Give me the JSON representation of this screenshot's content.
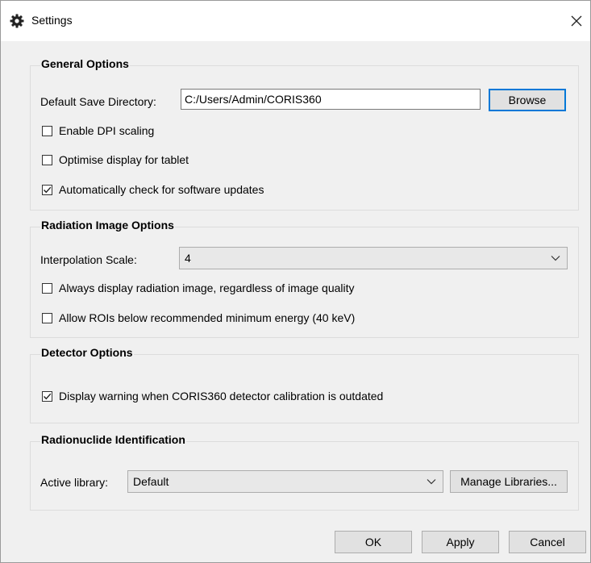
{
  "window": {
    "title": "Settings",
    "icon": "gear-icon",
    "close_glyph": "✕"
  },
  "general": {
    "title": "General Options",
    "save_dir_label": "Default Save Directory:",
    "save_dir_value": "C:/Users/Admin/CORIS360",
    "browse_label": "Browse",
    "checks": [
      {
        "label": "Enable DPI scaling",
        "checked": false
      },
      {
        "label": "Optimise display for tablet",
        "checked": false
      },
      {
        "label": "Automatically check for software updates",
        "checked": true
      }
    ]
  },
  "radiation": {
    "title": "Radiation Image Options",
    "interp_label": "Interpolation Scale:",
    "interp_value": "4",
    "checks": [
      {
        "label": "Always display radiation image, regardless of image quality",
        "checked": false
      },
      {
        "label": "Allow ROIs below recommended minimum energy (40 keV)",
        "checked": false
      }
    ]
  },
  "detector": {
    "title": "Detector Options",
    "checks": [
      {
        "label": "Display warning when CORIS360 detector calibration is outdated",
        "checked": true
      }
    ]
  },
  "radionuclide": {
    "title": "Radionuclide Identification",
    "active_label": "Active library:",
    "active_value": "Default",
    "manage_label": "Manage Libraries..."
  },
  "footer": {
    "ok_label": "OK",
    "apply_label": "Apply",
    "cancel_label": "Cancel"
  },
  "colors": {
    "accent": "#0078d7",
    "background": "#f0f0f0",
    "titlebar": "#ffffff"
  }
}
